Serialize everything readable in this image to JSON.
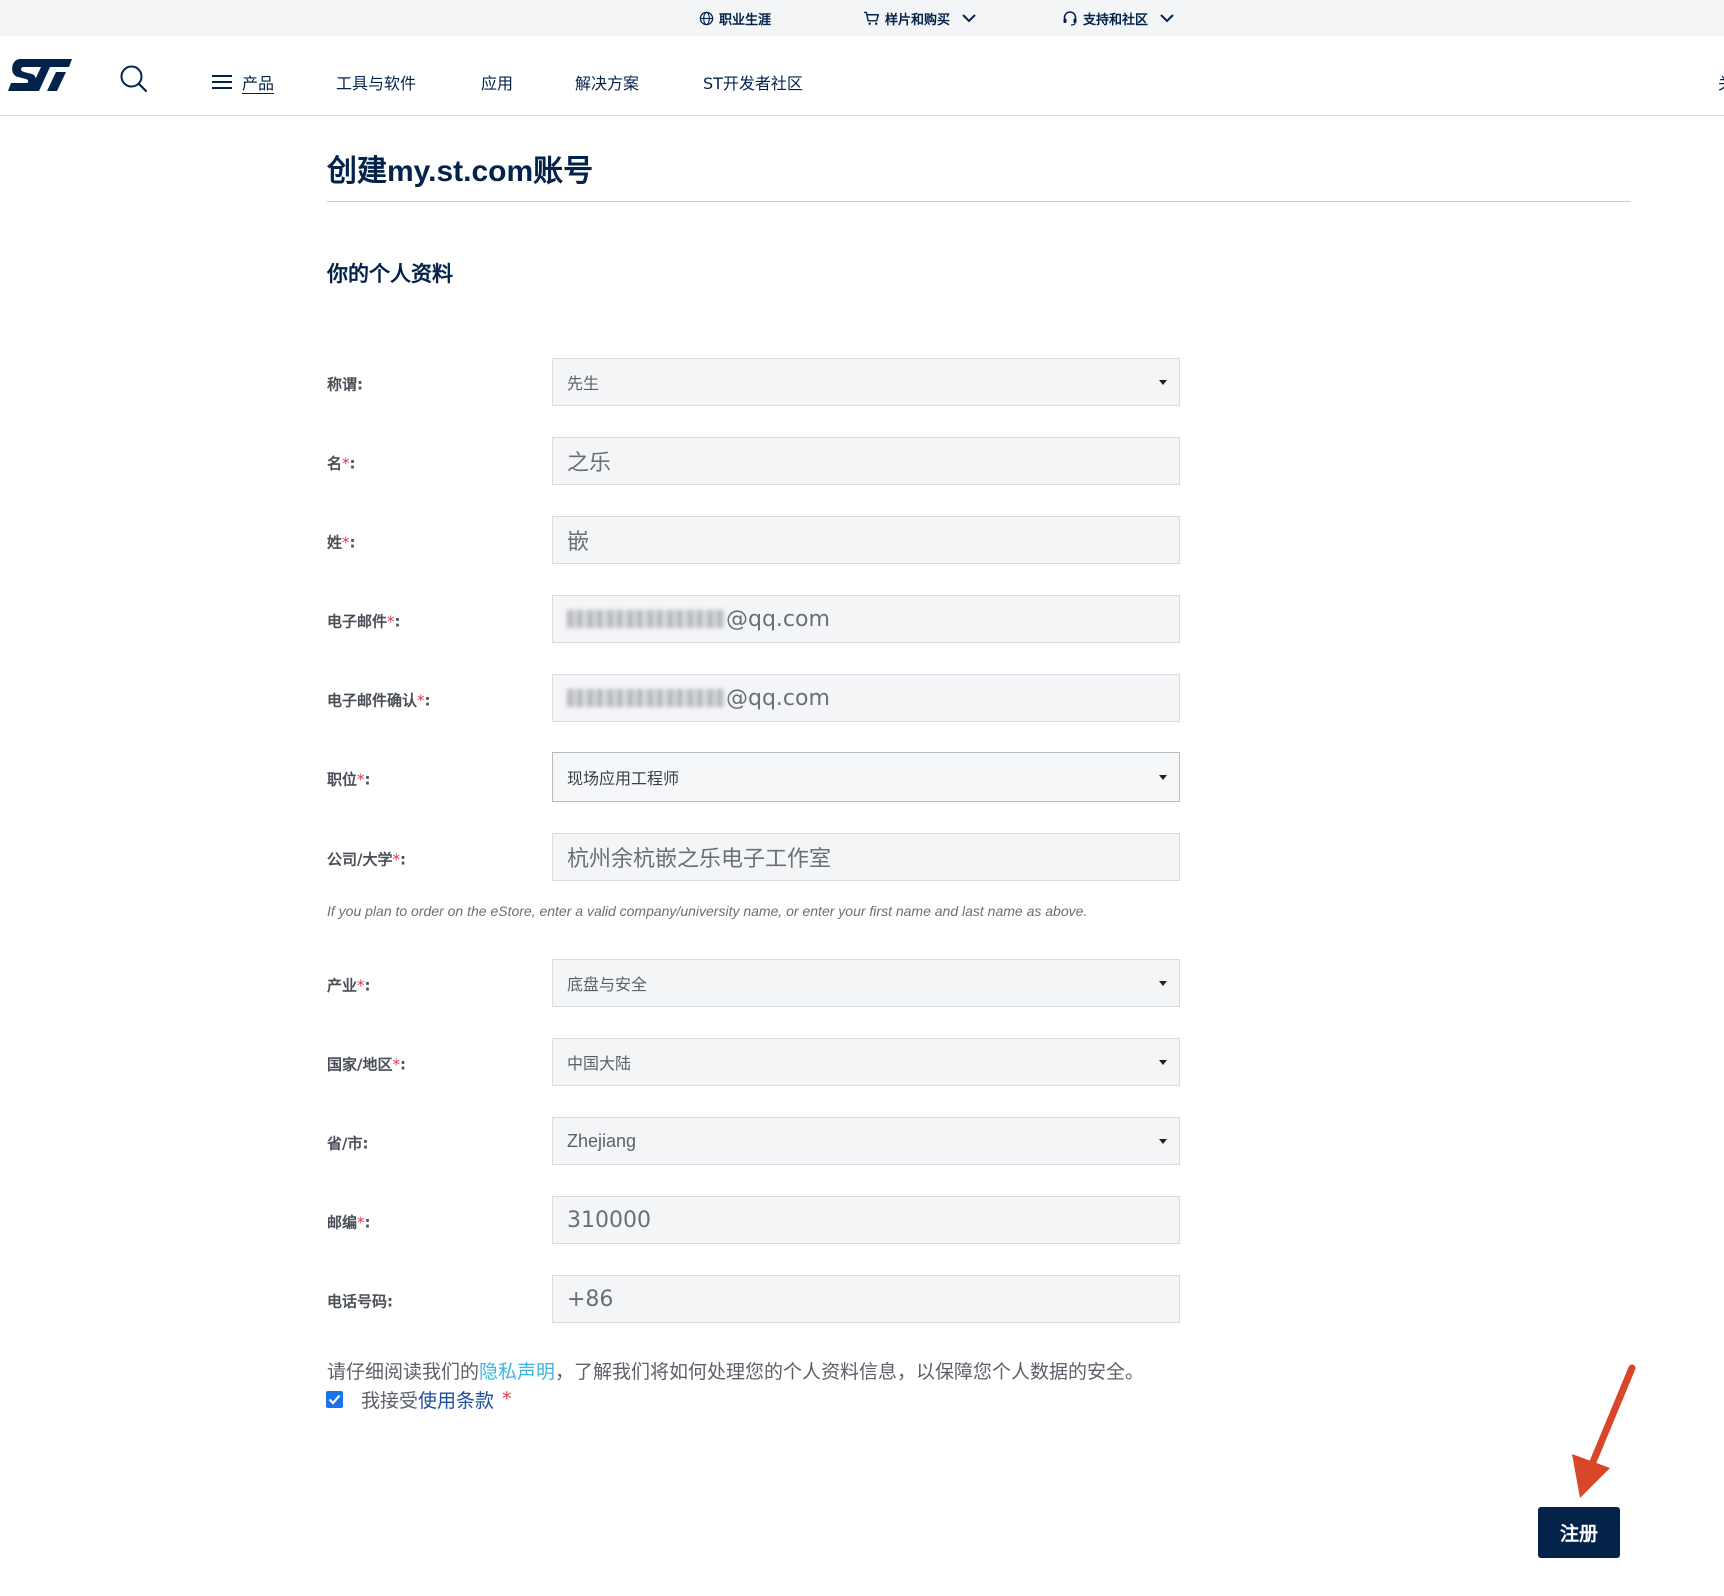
{
  "util_bar": {
    "careers": "职业生涯",
    "samples_buy": "样片和购买",
    "support": "支持和社区"
  },
  "nav": {
    "products": "产品",
    "tools": "工具与软件",
    "applications": "应用",
    "solutions": "解决方案",
    "community": "ST开发者社区",
    "cut_item": "关"
  },
  "page": {
    "title": "创建my.st.com账号",
    "section_title": "你的个人资料"
  },
  "form": {
    "required_mark": "*",
    "salutation": {
      "label": "称谓:",
      "value": "先生"
    },
    "first_name": {
      "label": "名",
      "suffix": ":",
      "value": "之乐"
    },
    "last_name": {
      "label": "姓",
      "suffix": ":",
      "value": "嵌"
    },
    "email": {
      "label": "电子邮件",
      "suffix": ":",
      "value_suffix": "@qq.com"
    },
    "email_confirm": {
      "label": "电子邮件确认",
      "suffix": ":",
      "value_suffix": "@qq.com"
    },
    "job": {
      "label": "职位",
      "suffix": ":",
      "value": "现场应用工程师"
    },
    "company": {
      "label": "公司/大学",
      "suffix": ":",
      "value": "杭州余杭嵌之乐电子工作室"
    },
    "company_hint": "If you plan to order on the eStore, enter a valid company/university name, or enter your first name and last name as above.",
    "industry": {
      "label": "产业",
      "suffix": ":",
      "value": "底盘与安全"
    },
    "country": {
      "label": "国家/地区",
      "suffix": ":",
      "value": "中国大陆"
    },
    "province": {
      "label": "省/市:",
      "value": "Zhejiang"
    },
    "postcode": {
      "label": "邮编",
      "suffix": ":",
      "value": "310000"
    },
    "phone": {
      "label": "电话号码:",
      "value": "+86"
    }
  },
  "privacy": {
    "before": "请仔细阅读我们的",
    "link": "隐私声明",
    "after": "，了解我们将如何处理您的个人资料信息，以保障您个人数据的安全。"
  },
  "terms": {
    "before": "我接受",
    "link": "使用条款",
    "required": "*",
    "checked": true
  },
  "submit_label": "注册",
  "colors": {
    "brand_navy": "#03234b",
    "link_cyan": "#3cb4e6",
    "required_red": "#e2374c",
    "annotation_arrow": "#d9472b"
  }
}
